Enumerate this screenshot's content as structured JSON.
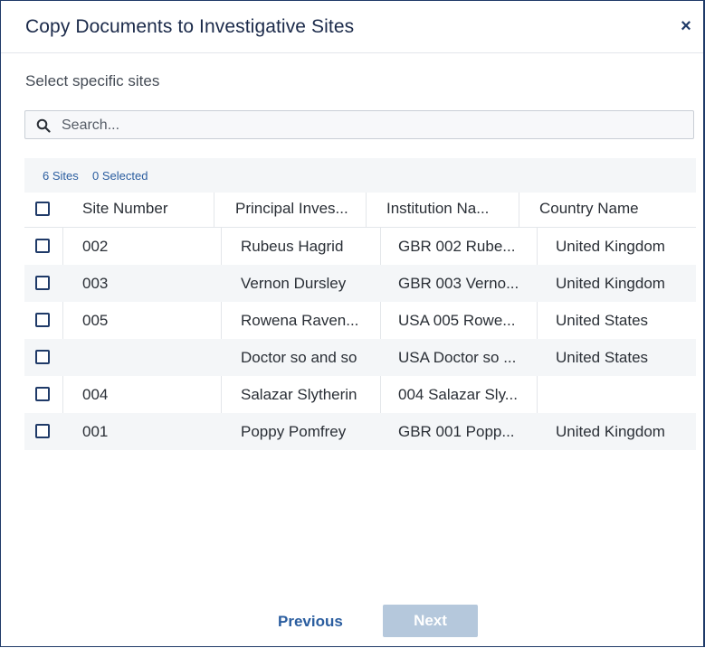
{
  "dialog": {
    "title": "Copy Documents to Investigative Sites",
    "close_glyph": "×",
    "subtitle": "Select specific sites"
  },
  "search": {
    "placeholder": "Search...",
    "value": ""
  },
  "table": {
    "count_text": "6 Sites",
    "selected_text": "0 Selected",
    "columns": [
      "Site Number",
      "Principal Inves...",
      "Institution Na...",
      "Country Name"
    ],
    "rows": [
      {
        "site_number": "002",
        "principal_investigator": "Rubeus Hagrid",
        "institution": "GBR 002 Rube...",
        "country": "United Kingdom",
        "checked": false
      },
      {
        "site_number": "003",
        "principal_investigator": "Vernon Dursley",
        "institution": "GBR 003 Verno...",
        "country": "United Kingdom",
        "checked": false
      },
      {
        "site_number": "005",
        "principal_investigator": "Rowena Raven...",
        "institution": "USA 005 Rowe...",
        "country": "United States",
        "checked": false
      },
      {
        "site_number": "",
        "principal_investigator": "Doctor so and so",
        "institution": "USA Doctor so ...",
        "country": "United States",
        "checked": false
      },
      {
        "site_number": "004",
        "principal_investigator": "Salazar Slytherin",
        "institution": "004 Salazar Sly...",
        "country": "",
        "checked": false
      },
      {
        "site_number": "001",
        "principal_investigator": "Poppy Pomfrey",
        "institution": "GBR 001 Popp...",
        "country": "United Kingdom",
        "checked": false
      }
    ]
  },
  "footer": {
    "previous_label": "Previous",
    "next_label": "Next"
  },
  "icons": {
    "search": "search-icon",
    "close": "close-icon"
  },
  "colors": {
    "accent": "#2a5d9f",
    "title": "#1b2a4a",
    "border": "#1f3a68",
    "next_disabled": "#b5c8dc",
    "row_alt": "#f4f6f8"
  }
}
